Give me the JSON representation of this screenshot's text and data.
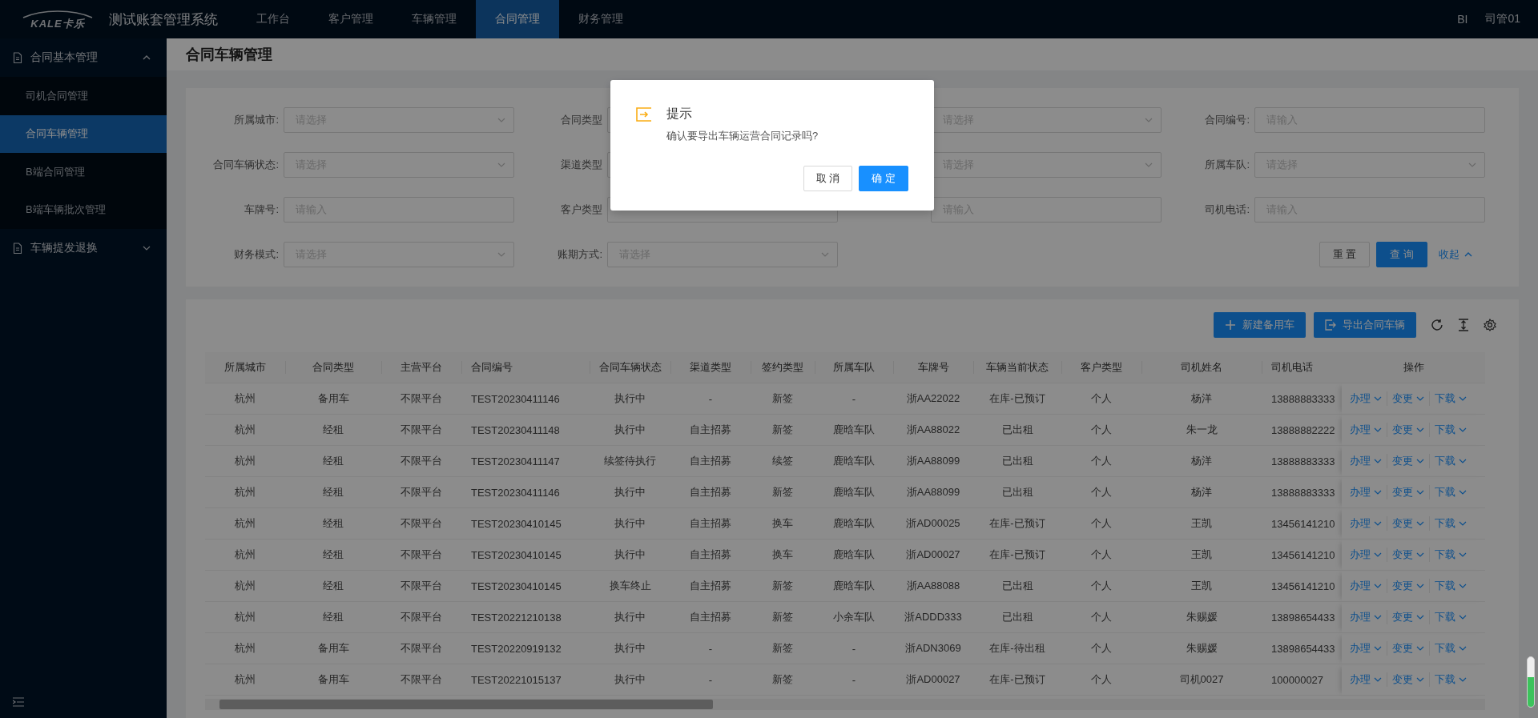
{
  "brand": {
    "logo_text": "KALE卡乐",
    "title": "测试账套管理系统"
  },
  "nav": [
    {
      "label": "工作台",
      "selected": false
    },
    {
      "label": "客户管理",
      "selected": false
    },
    {
      "label": "车辆管理",
      "selected": false
    },
    {
      "label": "合同管理",
      "selected": true
    },
    {
      "label": "财务管理",
      "selected": false
    }
  ],
  "user_menu": [
    "BI",
    "司管01"
  ],
  "sidebar": {
    "groups": [
      {
        "label": "合同基本管理",
        "expanded": true,
        "children": [
          {
            "label": "司机合同管理",
            "selected": false
          },
          {
            "label": "合同车辆管理",
            "selected": true
          },
          {
            "label": "B端合同管理",
            "selected": false
          },
          {
            "label": "B端车辆批次管理",
            "selected": false
          }
        ]
      },
      {
        "label": "车辆提发退换",
        "expanded": false
      }
    ]
  },
  "page_title": "合同车辆管理",
  "filters": [
    {
      "label": "所属城市:",
      "kind": "select",
      "placeholder": "请选择"
    },
    {
      "label": "合同类型",
      "kind": "select"
    },
    {
      "kind": "select",
      "placeholder": "请选择"
    },
    {
      "label": "合同编号:",
      "kind": "input",
      "placeholder": "请输入"
    },
    {
      "label": "合同车辆状态:",
      "kind": "select",
      "placeholder": "请选择"
    },
    {
      "label": "渠道类型",
      "kind": "select"
    },
    {
      "kind": "select",
      "placeholder": "请选择"
    },
    {
      "label": "所属车队:",
      "kind": "select",
      "placeholder": "请选择"
    },
    {
      "label": "车牌号:",
      "kind": "input",
      "placeholder": "请输入"
    },
    {
      "label": "客户类型",
      "kind": "select"
    },
    {
      "kind": "input",
      "placeholder": "请输入"
    },
    {
      "label": "司机电话:",
      "kind": "input",
      "placeholder": "请输入"
    },
    {
      "label": "财务模式:",
      "kind": "select",
      "placeholder": "请选择"
    },
    {
      "label": "账期方式:",
      "kind": "select",
      "placeholder": "请选择"
    }
  ],
  "filter_actions": {
    "reset": "重 置",
    "search": "查 询",
    "collapse": "收起"
  },
  "toolbar": {
    "buttons": [
      "新建备用车",
      "导出合同车辆"
    ]
  },
  "table": {
    "columns": [
      "所属城市",
      "合同类型",
      "主营平台",
      "合同编号",
      "合同车辆状态",
      "渠道类型",
      "签约类型",
      "所属车队",
      "车牌号",
      "车辆当前状态",
      "客户类型",
      "司机姓名",
      "司机电话",
      "操作"
    ],
    "rows": [
      {
        "cells": [
          "杭州",
          "备用车",
          "不限平台",
          "TEST20230411146",
          "执行中",
          "-",
          "新签",
          "-",
          "浙AA22022",
          "在库-已预订",
          "个人",
          "杨洋",
          "13888883333"
        ],
        "actions": [
          "办理",
          "变更",
          "下载"
        ]
      },
      {
        "cells": [
          "杭州",
          "经租",
          "不限平台",
          "TEST20230411148",
          "执行中",
          "自主招募",
          "新签",
          "鹿晗车队",
          "浙AA88022",
          "已出租",
          "个人",
          "朱一龙",
          "13888882222"
        ],
        "actions": [
          "办理",
          "变更",
          "下载"
        ]
      },
      {
        "cells": [
          "杭州",
          "经租",
          "不限平台",
          "TEST20230411147",
          "续签待执行",
          "自主招募",
          "续签",
          "鹿晗车队",
          "浙AA88099",
          "已出租",
          "个人",
          "杨洋",
          "13888883333"
        ],
        "actions": [
          "办理",
          "变更",
          "下载"
        ]
      },
      {
        "cells": [
          "杭州",
          "经租",
          "不限平台",
          "TEST20230411146",
          "执行中",
          "自主招募",
          "新签",
          "鹿晗车队",
          "浙AA88099",
          "已出租",
          "个人",
          "杨洋",
          "13888883333"
        ],
        "actions": [
          "办理",
          "变更",
          "下载"
        ]
      },
      {
        "cells": [
          "杭州",
          "经租",
          "不限平台",
          "TEST20230410145",
          "执行中",
          "自主招募",
          "换车",
          "鹿晗车队",
          "浙AD00025",
          "在库-已预订",
          "个人",
          "王凯",
          "13456141210"
        ],
        "actions": [
          "办理",
          "变更",
          "下载"
        ]
      },
      {
        "cells": [
          "杭州",
          "经租",
          "不限平台",
          "TEST20230410145",
          "执行中",
          "自主招募",
          "换车",
          "鹿晗车队",
          "浙AD00027",
          "在库-已预订",
          "个人",
          "王凯",
          "13456141210"
        ],
        "actions": [
          "办理",
          "变更",
          "下载"
        ]
      },
      {
        "cells": [
          "杭州",
          "经租",
          "不限平台",
          "TEST20230410145",
          "换车终止",
          "自主招募",
          "新签",
          "鹿晗车队",
          "浙AA88088",
          "已出租",
          "个人",
          "王凯",
          "13456141210"
        ],
        "actions": [
          "办理",
          "变更",
          "下载"
        ]
      },
      {
        "cells": [
          "杭州",
          "经租",
          "不限平台",
          "TEST20221210138",
          "执行中",
          "自主招募",
          "新签",
          "小余车队",
          "浙ADDD333",
          "已出租",
          "个人",
          "朱赐媛",
          "13898654433"
        ],
        "actions": [
          "办理",
          "变更",
          "下载"
        ]
      },
      {
        "cells": [
          "杭州",
          "备用车",
          "不限平台",
          "TEST20220919132",
          "执行中",
          "-",
          "新签",
          "-",
          "浙ADN3069",
          "在库-待出租",
          "个人",
          "朱赐媛",
          "13898654433"
        ],
        "actions": [
          "办理",
          "变更",
          "下载"
        ]
      },
      {
        "cells": [
          "杭州",
          "备用车",
          "不限平台",
          "TEST20221015137",
          "执行中",
          "-",
          "新签",
          "-",
          "浙AD00027",
          "在库-已预订",
          "个人",
          "司机0027",
          "100000027"
        ],
        "actions": [
          "办理",
          "变更",
          "下载"
        ]
      }
    ]
  },
  "dialog": {
    "title": "提示",
    "message": "确认要导出车辆运营合同记录吗?",
    "buttons": [
      {
        "label": "取 消",
        "kind": "default"
      },
      {
        "label": "确 定",
        "kind": "primary"
      }
    ]
  }
}
